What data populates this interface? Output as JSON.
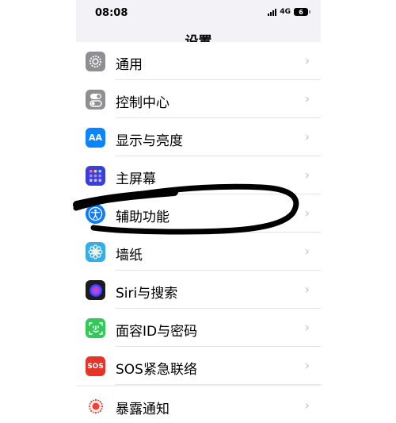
{
  "status_bar": {
    "time": "08:08",
    "network": "4G",
    "battery": "6"
  },
  "header": {
    "title": "设置"
  },
  "settings": [
    {
      "label": "通用",
      "icon": "gear-icon",
      "color": "#8e8e93"
    },
    {
      "label": "控制中心",
      "icon": "toggle-icon",
      "color": "#8e8e93"
    },
    {
      "label": "显示与亮度",
      "icon": "text-size-icon",
      "color": "#0a84ff",
      "glyph": "AA"
    },
    {
      "label": "主屏幕",
      "icon": "home-grid-icon",
      "color": "#3b3fd8"
    },
    {
      "label": "辅助功能",
      "icon": "accessibility-icon",
      "color": "#0a7aff"
    },
    {
      "label": "墙纸",
      "icon": "flower-icon",
      "color": "#32ade6"
    },
    {
      "label": "Siri与搜索",
      "icon": "siri-icon",
      "color": "#1c1c1e"
    },
    {
      "label": "面容ID与密码",
      "icon": "face-id-icon",
      "color": "#34c759"
    },
    {
      "label": "SOS紧急联络",
      "icon": "sos-icon",
      "color": "#e5352b",
      "glyph": "SOS"
    },
    {
      "label": "暴露通知",
      "icon": "exposure-icon",
      "color": "#ffffff"
    }
  ],
  "chevron": "›",
  "accent": "#000000"
}
